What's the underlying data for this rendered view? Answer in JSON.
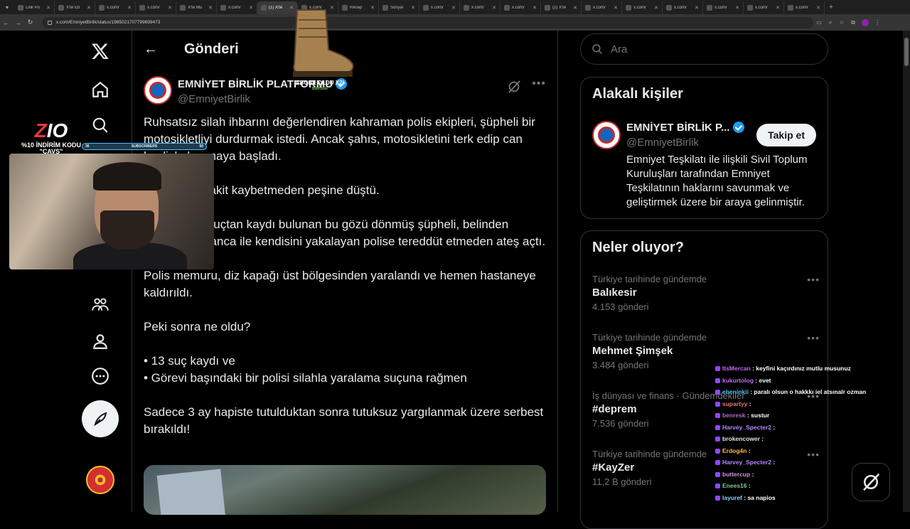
{
  "browser": {
    "tabs": [
      {
        "label": "Link Po",
        "active": false
      },
      {
        "label": "X'te Eb",
        "active": false
      },
      {
        "label": "x.com/",
        "active": false
      },
      {
        "label": "x.com/",
        "active": false
      },
      {
        "label": "X'te Mu",
        "active": false
      },
      {
        "label": "x.com/",
        "active": false
      },
      {
        "label": "(1) X'te",
        "active": true
      },
      {
        "label": "x.com/",
        "active": false
      },
      {
        "label": "Recep",
        "active": false
      },
      {
        "label": "Sosyal",
        "active": false
      },
      {
        "label": "x.com/",
        "active": false
      },
      {
        "label": "x.com/",
        "active": false
      },
      {
        "label": "x.com/",
        "active": false
      },
      {
        "label": "(2) X'te",
        "active": false
      },
      {
        "label": "x.com/",
        "active": false
      },
      {
        "label": "x.com/",
        "active": false
      },
      {
        "label": "x.com/",
        "active": false
      },
      {
        "label": "x.com/",
        "active": false
      },
      {
        "label": "x.com/",
        "active": false
      },
      {
        "label": "x.com/",
        "active": false
      }
    ],
    "url": "x.com/EmniyetBirlik/status/1985021707799699473"
  },
  "header": {
    "title": "Gönderi"
  },
  "post": {
    "author_name": "EMNİYET BİRLİK PLATFORMU",
    "author_handle": "@EmniyetBirlik",
    "paragraphs": [
      "Ruhsatsız silah ihbarını değerlendiren kahraman polis ekipleri, şüpheli bir motosikletliyi durdurmak istedi. Ancak şahıs, motosikletini terk edip can havliyle kaçmaya başladı.",
      "Polisler de vakit kaybetmeden peşine düştü.",
      "Çok sayıda suçtan kaydı bulunan bu gözü dönmüş şüpheli, belinden çıkardığı tabanca ile kendisini yakalayan polise tereddüt etmeden ateş açtı.",
      "Polis memuru, diz kapağı üst bölgesinden yaralandı ve hemen hastaneye kaldırıldı.",
      "Peki sonra ne oldu?",
      "• 13 suç kaydı ve\n• Görevi başındaki bir polisi silahla yaralama suçuna rağmen",
      "Sadece 3 ay hapiste tutulduktan sonra tutuksuz yargılanmak üzere serbest bırakıldı!"
    ]
  },
  "search": {
    "placeholder": "Ara"
  },
  "related": {
    "title": "Alakalı kişiler",
    "name": "EMNİYET BİRLİK P...",
    "handle": "@EmniyetBirlik",
    "follow_label": "Takip et",
    "bio": "Emniyet Teşkilatı ile ilişkili Sivil Toplum Kuruluşları tarafından Emniyet Teşkilatının haklarını savunmak ve geliştirmek üzere bir araya gelinmiştir."
  },
  "trends": {
    "title": "Neler oluyor?",
    "items": [
      {
        "context": "Türkiye tarihinde gündemde",
        "name": "Balıkesir",
        "count": "4.153 gönderi"
      },
      {
        "context": "Türkiye tarihinde gündemde",
        "name": "Mehmet Şimşek",
        "count": "3.484 gönderi"
      },
      {
        "context": "İş dünyası ve finans · Gündemdekiler",
        "name": "#deprem",
        "count": "7.536 gönderi"
      },
      {
        "context": "Türkiye tarihinde gündemde",
        "name": "#KayZer",
        "count": "11,2 B gönderi"
      }
    ]
  },
  "overlay": {
    "logo_text": "Z",
    "logo_text2": "IO",
    "promo_line1": "%10 İNDİRİM KODU",
    "promo_line2": "\"CAVS\"",
    "sub_left": "36",
    "sub_mid": "SUBSCRIBERS",
    "sub_right": "50",
    "boot_caption1": "ABONE OLDU X2!",
    "boot_caption2": "sunsur"
  },
  "chat": [
    {
      "user": "ItsMercan",
      "msg": ": keyfini kaçırdınız mutlu musunuz",
      "color": "#c36cf5"
    },
    {
      "user": "kukurtolog",
      "msg": ": evet",
      "color": "#c36cf5"
    },
    {
      "user": "ebeninkii",
      "msg": ": paralı olsun o hakkkı iel atsınalr ozman",
      "color": "#4fc3f7"
    },
    {
      "user": "supartyy",
      "msg": ":",
      "color": "#e57373"
    },
    {
      "user": "benresk",
      "msg": ": sustur",
      "color": "#ba68c8"
    },
    {
      "user": "Harvey_Specter2",
      "msg": ":",
      "color": "#b388ff"
    },
    {
      "user": "brokencower",
      "msg": ":",
      "color": "#e0e0e0"
    },
    {
      "user": "Erdog4n",
      "msg": ":",
      "color": "#ffb74d"
    },
    {
      "user": "Harvey_Specter2",
      "msg": ":",
      "color": "#b388ff"
    },
    {
      "user": "buttercup",
      "msg": ":",
      "color": "#ce93d8"
    },
    {
      "user": "Enees16",
      "msg": ":",
      "color": "#81c784"
    },
    {
      "user": "layuref",
      "msg": ": sa napios",
      "color": "#90caf9"
    }
  ]
}
